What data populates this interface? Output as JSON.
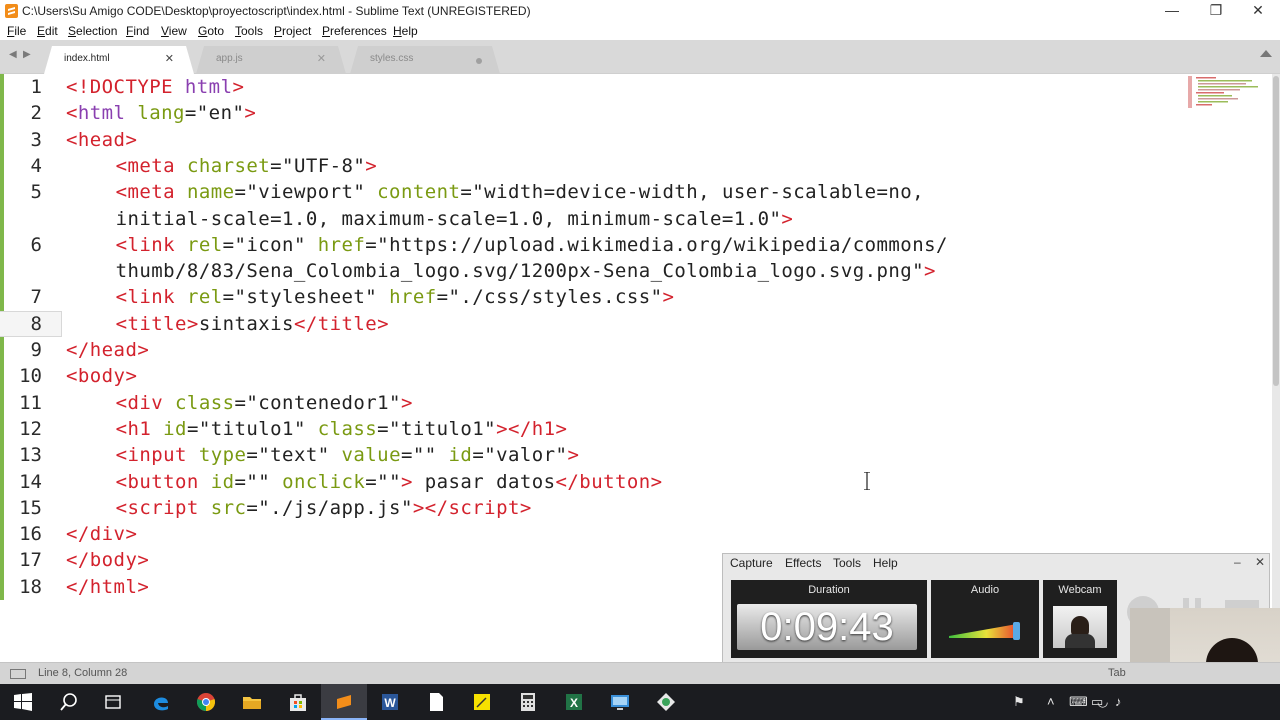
{
  "window": {
    "title": "C:\\Users\\Su Amigo CODE\\Desktop\\proyectoscript\\index.html - Sublime Text (UNREGISTERED)",
    "minimize": "—",
    "restore": "❐",
    "close": "✕"
  },
  "menu": {
    "items": [
      {
        "u": "F",
        "rest": "ile"
      },
      {
        "u": "E",
        "rest": "dit"
      },
      {
        "u": "S",
        "rest": "election"
      },
      {
        "u": "F",
        "rest": "ind"
      },
      {
        "u": "V",
        "rest": "iew"
      },
      {
        "u": "G",
        "rest": "oto"
      },
      {
        "u": "T",
        "rest": "ools"
      },
      {
        "u": "P",
        "rest": "roject"
      },
      {
        "u": "P",
        "rest": "references"
      },
      {
        "u": "H",
        "rest": "elp"
      }
    ]
  },
  "tabs": [
    {
      "label": "index.html",
      "active": true,
      "state": "close"
    },
    {
      "label": "app.js",
      "active": false,
      "state": "close"
    },
    {
      "label": "styles.css",
      "active": false,
      "state": "dirty"
    }
  ],
  "tab_nav": {
    "left": "◀",
    "right": "▶"
  },
  "editor": {
    "lines": [
      {
        "n": "1",
        "indent": 0,
        "html": "<span class=\"tag\">&lt;!</span><span class=\"doct\">DOCTYPE</span> <span class=\"kw\">html</span><span class=\"tag\">&gt;</span>"
      },
      {
        "n": "2",
        "indent": 0,
        "html": "<span class=\"tag\">&lt;</span><span class=\"kw\">html</span> <span class=\"attr\">lang</span>=\"en\"<span class=\"tag\">&gt;</span>"
      },
      {
        "n": "3",
        "indent": 0,
        "html": "<span class=\"tag\">&lt;head&gt;</span>"
      },
      {
        "n": "4",
        "indent": 1,
        "html": "<span class=\"tag\">&lt;meta</span> <span class=\"attr\">charset</span>=\"UTF-8\"<span class=\"tag\">&gt;</span>"
      },
      {
        "n": "5",
        "indent": 1,
        "html": "<span class=\"tag\">&lt;meta</span> <span class=\"attr\">name</span>=\"viewport\" <span class=\"attr\">content</span>=\"width=device-width, user-scalable=no,",
        "wrap": "initial-scale=1.0, maximum-scale=1.0, minimum-scale=1.0\"<span class=\"tag\">&gt;</span>"
      },
      {
        "n": "6",
        "indent": 1,
        "html": "<span class=\"tag\">&lt;link</span> <span class=\"attr\">rel</span>=\"icon\" <span class=\"attr\">href</span>=\"https://upload.wikimedia.org/wikipedia/commons/",
        "wrap": "thumb/8/83/Sena_Colombia_logo.svg/1200px-Sena_Colombia_logo.svg.png\"<span class=\"tag\">&gt;</span>"
      },
      {
        "n": "7",
        "indent": 1,
        "html": "<span class=\"tag\">&lt;link</span> <span class=\"attr\">rel</span>=\"stylesheet\" <span class=\"attr\">href</span>=\"./css/styles.css\"<span class=\"tag\">&gt;</span>"
      },
      {
        "n": "8",
        "indent": 1,
        "html": "<span class=\"tag\">&lt;title&gt;</span>sintaxis<span class=\"tag\">&lt;/title&gt;</span>"
      },
      {
        "n": "9",
        "indent": 0,
        "html": "<span class=\"tag\">&lt;/head&gt;</span>"
      },
      {
        "n": "10",
        "indent": 0,
        "html": "<span class=\"tag\">&lt;body&gt;</span>"
      },
      {
        "n": "11",
        "indent": 1,
        "html": "<span class=\"tag\">&lt;div</span> <span class=\"attr\">class</span>=\"contenedor1\"<span class=\"tag\">&gt;</span>"
      },
      {
        "n": "12",
        "indent": 1,
        "html": "<span class=\"tag\">&lt;h1</span> <span class=\"attr\">id</span>=\"titulo1\" <span class=\"attr\">class</span>=\"titulo1\"<span class=\"tag\">&gt;&lt;/h1&gt;</span>"
      },
      {
        "n": "13",
        "indent": 1,
        "html": "<span class=\"tag\">&lt;input</span> <span class=\"attr\">type</span>=\"text\" <span class=\"attr\">value</span>=\"\" <span class=\"attr\">id</span>=\"valor\"<span class=\"tag\">&gt;</span>"
      },
      {
        "n": "14",
        "indent": 1,
        "html": "<span class=\"tag\">&lt;button</span> <span class=\"attr\">id</span>=\"\" <span class=\"attr\">onclick</span>=\"\"<span class=\"tag\">&gt;</span> pasar datos<span class=\"tag\">&lt;/button&gt;</span>"
      },
      {
        "n": "15",
        "indent": 1,
        "html": "<span class=\"tag\">&lt;script</span> <span class=\"attr\">src</span>=\"./js/app.js\"<span class=\"tag\">&gt;&lt;/script&gt;</span>"
      },
      {
        "n": "16",
        "indent": 0,
        "html": "<span class=\"tag\">&lt;/div&gt;</span>"
      },
      {
        "n": "17",
        "indent": 0,
        "html": "<span class=\"tag\">&lt;/body&gt;</span>"
      },
      {
        "n": "18",
        "indent": 0,
        "html": "<span class=\"tag\">&lt;/html&gt;</span>"
      }
    ]
  },
  "recorder": {
    "menu": [
      "Capture",
      "Effects",
      "Tools",
      "Help"
    ],
    "minimize": "–",
    "close": "✕",
    "duration_label": "Duration",
    "duration_value": "0:09:43",
    "audio_label": "Audio",
    "webcam_label": "Webcam"
  },
  "status": {
    "position": "Line 8, Column 28",
    "right": "Tab"
  },
  "taskbar": {
    "apps": [
      "start",
      "search",
      "task-view",
      "edge",
      "chrome",
      "file-explorer",
      "store",
      "sublime-text",
      "word",
      "notepad",
      "sticky-notes",
      "calculator",
      "excel",
      "remote-desktop",
      "camtasia"
    ],
    "tray": [
      "⚑",
      "˄",
      "⌨",
      "▭",
      "◡",
      "♪"
    ]
  },
  "colors": {
    "tag": "#d3222d",
    "attr": "#7a9a12",
    "keyword": "#8a3fb0",
    "gutter_mark": "#7fb84a",
    "taskbar": "#1b1c20"
  }
}
